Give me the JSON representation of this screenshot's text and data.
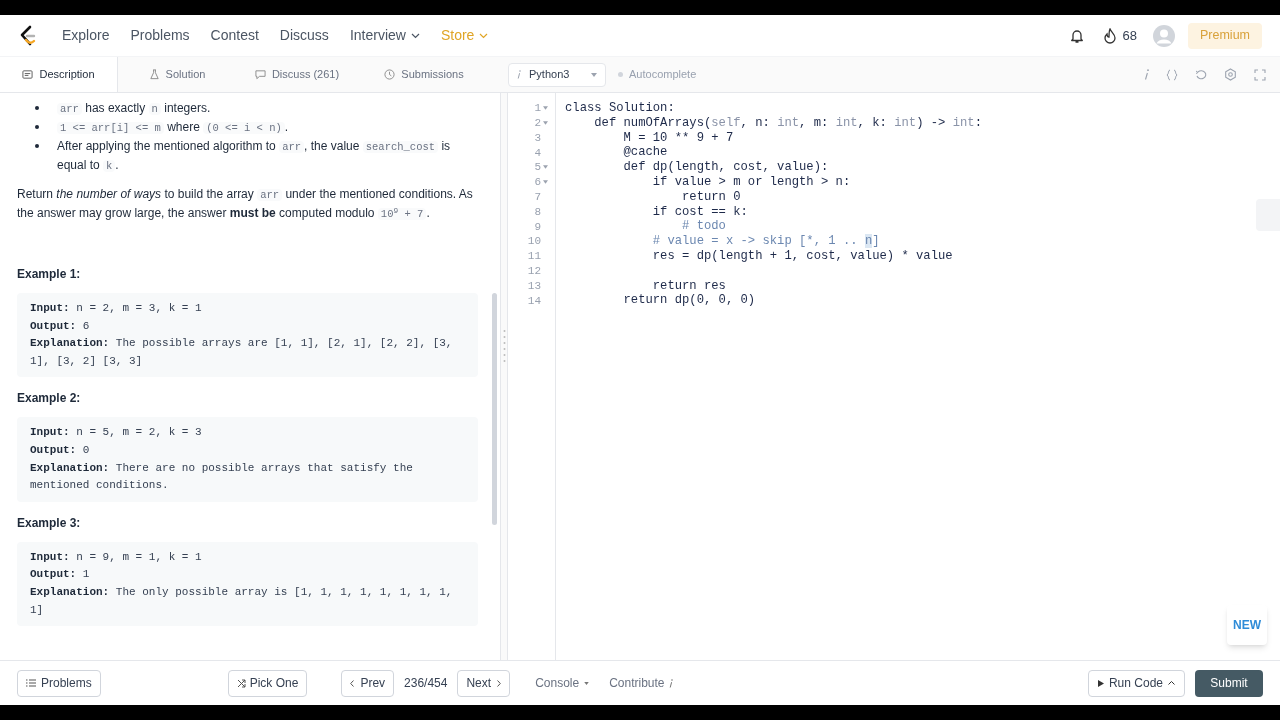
{
  "nav": {
    "items": [
      {
        "label": "Explore",
        "dropdown": false,
        "color": "#4b5563"
      },
      {
        "label": "Problems",
        "dropdown": false,
        "color": "#4b5563"
      },
      {
        "label": "Contest",
        "dropdown": false,
        "color": "#4b5563"
      },
      {
        "label": "Discuss",
        "dropdown": false,
        "color": "#4b5563"
      },
      {
        "label": "Interview",
        "dropdown": true,
        "color": "#4b5563"
      },
      {
        "label": "Store",
        "dropdown": true,
        "color": "#e0a526"
      }
    ],
    "streak": "68",
    "premium": "Premium"
  },
  "tabs": [
    {
      "label": "Description",
      "selected": true
    },
    {
      "label": "Solution",
      "selected": false
    },
    {
      "label": "Discuss (261)",
      "selected": false
    },
    {
      "label": "Submissions",
      "selected": false
    }
  ],
  "editor_toolbar": {
    "language": "Python3",
    "autocomplete": {
      "label": "Autocomplete",
      "on": false
    }
  },
  "description": {
    "bullets": [
      [
        {
          "kind": "code",
          "text": "arr"
        },
        {
          "kind": "text",
          "text": " has exactly "
        },
        {
          "kind": "code",
          "text": "n"
        },
        {
          "kind": "text",
          "text": " integers."
        }
      ],
      [
        {
          "kind": "code",
          "text": "1 <= arr[i] <= m"
        },
        {
          "kind": "text",
          "text": " where "
        },
        {
          "kind": "code",
          "text": "(0 <= i < n)"
        },
        {
          "kind": "text",
          "text": "."
        }
      ],
      [
        {
          "kind": "text",
          "text": "After applying the mentioned algorithm to "
        },
        {
          "kind": "code",
          "text": "arr"
        },
        {
          "kind": "text",
          "text": ", the value "
        },
        {
          "kind": "code",
          "text": "search_cost"
        },
        {
          "kind": "text",
          "text": " is equal to "
        },
        {
          "kind": "code",
          "text": "k"
        },
        {
          "kind": "text",
          "text": "."
        }
      ]
    ],
    "paragraph": [
      {
        "kind": "text",
        "text": "Return *the number of ways* to build the array "
      },
      {
        "kind": "code",
        "text": "arr"
      },
      {
        "kind": "text",
        "text": " under the mentioned conditions. As the answer may grow large, the answer **must be** computed modulo "
      },
      {
        "kind": "code",
        "text": "10$^{9}$ + 7"
      },
      {
        "kind": "text",
        "text": "."
      }
    ],
    "examples": [
      {
        "title": "Example 1:",
        "lines": [
          {
            "label": "Input:",
            "text": "n = 2, m = 3, k = 1"
          },
          {
            "label": "Output:",
            "text": "6"
          },
          {
            "label": "Explanation:",
            "text": "The possible arrays are [1, 1], [2, 1], [2, 2], [3, 1], [3, 2] [3, 3]"
          }
        ]
      },
      {
        "title": "Example 2:",
        "lines": [
          {
            "label": "Input:",
            "text": "n = 5, m = 2, k = 3"
          },
          {
            "label": "Output:",
            "text": "0"
          },
          {
            "label": "Explanation:",
            "text": "There are no possible arrays that satisfy the mentioned conditions."
          }
        ]
      },
      {
        "title": "Example 3:",
        "lines": [
          {
            "label": "Input:",
            "text": "n = 9, m = 1, k = 1"
          },
          {
            "label": "Output:",
            "text": "1"
          },
          {
            "label": "Explanation:",
            "text": "The only possible array is [1, 1, 1, 1, 1, 1, 1, 1, 1]"
          }
        ]
      }
    ]
  },
  "code": [
    {
      "number": "1",
      "fold": true,
      "tokens": [
        {
          "kind": "plain",
          "text": "class Solution:"
        }
      ]
    },
    {
      "number": "2",
      "fold": true,
      "tokens": [
        {
          "kind": "plain",
          "text": "    def numOfArrays("
        },
        {
          "kind": "muted",
          "text": "self"
        },
        {
          "kind": "plain",
          "text": ", n: "
        },
        {
          "kind": "muted",
          "text": "int"
        },
        {
          "kind": "plain",
          "text": ", m: "
        },
        {
          "kind": "muted",
          "text": "int"
        },
        {
          "kind": "plain",
          "text": ", k: "
        },
        {
          "kind": "muted",
          "text": "int"
        },
        {
          "kind": "plain",
          "text": ") -> "
        },
        {
          "kind": "muted",
          "text": "int"
        },
        {
          "kind": "plain",
          "text": ":"
        }
      ]
    },
    {
      "number": "3",
      "fold": false,
      "tokens": [
        {
          "kind": "plain",
          "text": "        M = 10 ** 9 + 7"
        }
      ]
    },
    {
      "number": "4",
      "fold": false,
      "tokens": [
        {
          "kind": "plain",
          "text": "        @cache"
        }
      ]
    },
    {
      "number": "5",
      "fold": true,
      "tokens": [
        {
          "kind": "plain",
          "text": "        def dp(length, cost, value):"
        }
      ]
    },
    {
      "number": "6",
      "fold": true,
      "tokens": [
        {
          "kind": "plain",
          "text": "            if value > m or length > n:"
        }
      ]
    },
    {
      "number": "7",
      "fold": false,
      "tokens": [
        {
          "kind": "plain",
          "text": "                return 0"
        }
      ]
    },
    {
      "number": "8",
      "fold": false,
      "tokens": [
        {
          "kind": "plain",
          "text": "            if cost == k:"
        }
      ]
    },
    {
      "number": "9",
      "fold": false,
      "tokens": [
        {
          "kind": "comment",
          "text": "                # todo"
        }
      ]
    },
    {
      "number": "10",
      "fold": false,
      "tokens": [
        {
          "kind": "comment",
          "text": "            # value = x -> skip [*, 1 .. "
        },
        {
          "kind": "match",
          "text": "n"
        },
        {
          "kind": "comment",
          "text": "]"
        }
      ]
    },
    {
      "number": "11",
      "fold": false,
      "tokens": [
        {
          "kind": "plain",
          "text": "            res = dp(length + 1, cost, value) * value"
        }
      ]
    },
    {
      "number": "12",
      "fold": false
    },
    {
      "number": "13",
      "fold": false,
      "tokens": [
        {
          "kind": "plain",
          "text": "            return res"
        }
      ]
    },
    {
      "number": "14",
      "fold": false,
      "tokens": [
        {
          "kind": "plain",
          "text": "        return dp(0, 0, 0)"
        }
      ]
    }
  ],
  "new_badge": "NEW",
  "footer": {
    "problems": "Problems",
    "pick_one": "Pick One",
    "prev": "Prev",
    "counter": "236/454",
    "next": "Next",
    "console": "Console",
    "contribute": "Contribute",
    "run_code": "Run Code",
    "submit": "Submit"
  }
}
